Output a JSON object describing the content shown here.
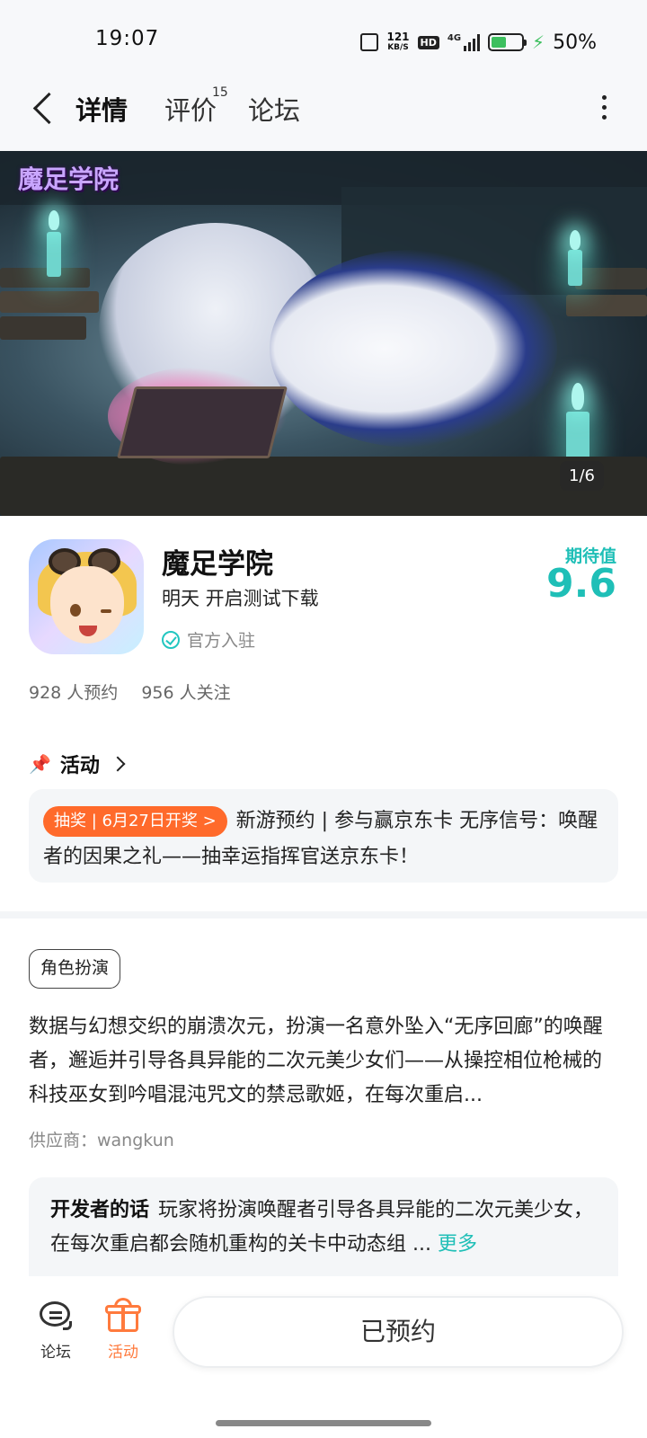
{
  "status_bar": {
    "time": "19:07",
    "net_speed_value": "121",
    "net_speed_unit": "KB/S",
    "hd_badge": "HD",
    "network": "4G",
    "battery_pct": "50%",
    "battery_level": 0.5,
    "icons": [
      "vibrate-icon",
      "hd-icon",
      "signal-icon",
      "battery-icon",
      "charging-icon"
    ]
  },
  "nav": {
    "tabs": [
      {
        "label": "详情",
        "active": true
      },
      {
        "label": "评价",
        "badge": "15"
      },
      {
        "label": "论坛"
      }
    ],
    "icons": [
      "back-icon",
      "more-icon"
    ]
  },
  "banner": {
    "logo_text": "魔足学院",
    "counter": "1/6"
  },
  "game": {
    "title": "魔足学院",
    "subtitle": "明天 开启测试下载",
    "official": "官方入驻",
    "expect_label": "期待值",
    "expect_value": "9.6",
    "reservations": "928 人预约",
    "followers": "956 人关注"
  },
  "activity": {
    "title": "活动",
    "tag": "抽奖 | 6月27日开奖 >",
    "text": "新游预约 | 参与赢京东卡 无序信号：唤醒者的因果之礼——抽幸运指挥官送京东卡！"
  },
  "genre_tag": "角色扮演",
  "description": "数据与幻想交织的崩溃次元，扮演一名意外坠入“无序回廊”的唤醒者，邂逅并引导各具异能的二次元美少女们——从操控相位枪械的科技巫女到吟唱混沌咒文的禁忌歌姬，在每次重启...",
  "supplier": "供应商：wangkun",
  "dev_note": {
    "label": "开发者的话",
    "text": "玩家将扮演唤醒者引导各具异能的二次元美少女，在每次重启都会随机重构的关卡中动态组 ...",
    "more": "更多"
  },
  "bottom_bar": {
    "forum_label": "论坛",
    "activity_label": "活动",
    "reserve_button": "已预约"
  },
  "colors": {
    "accent": "#22c6c0",
    "orange": "#ff6a2b",
    "expect": "#1fbfb7"
  }
}
